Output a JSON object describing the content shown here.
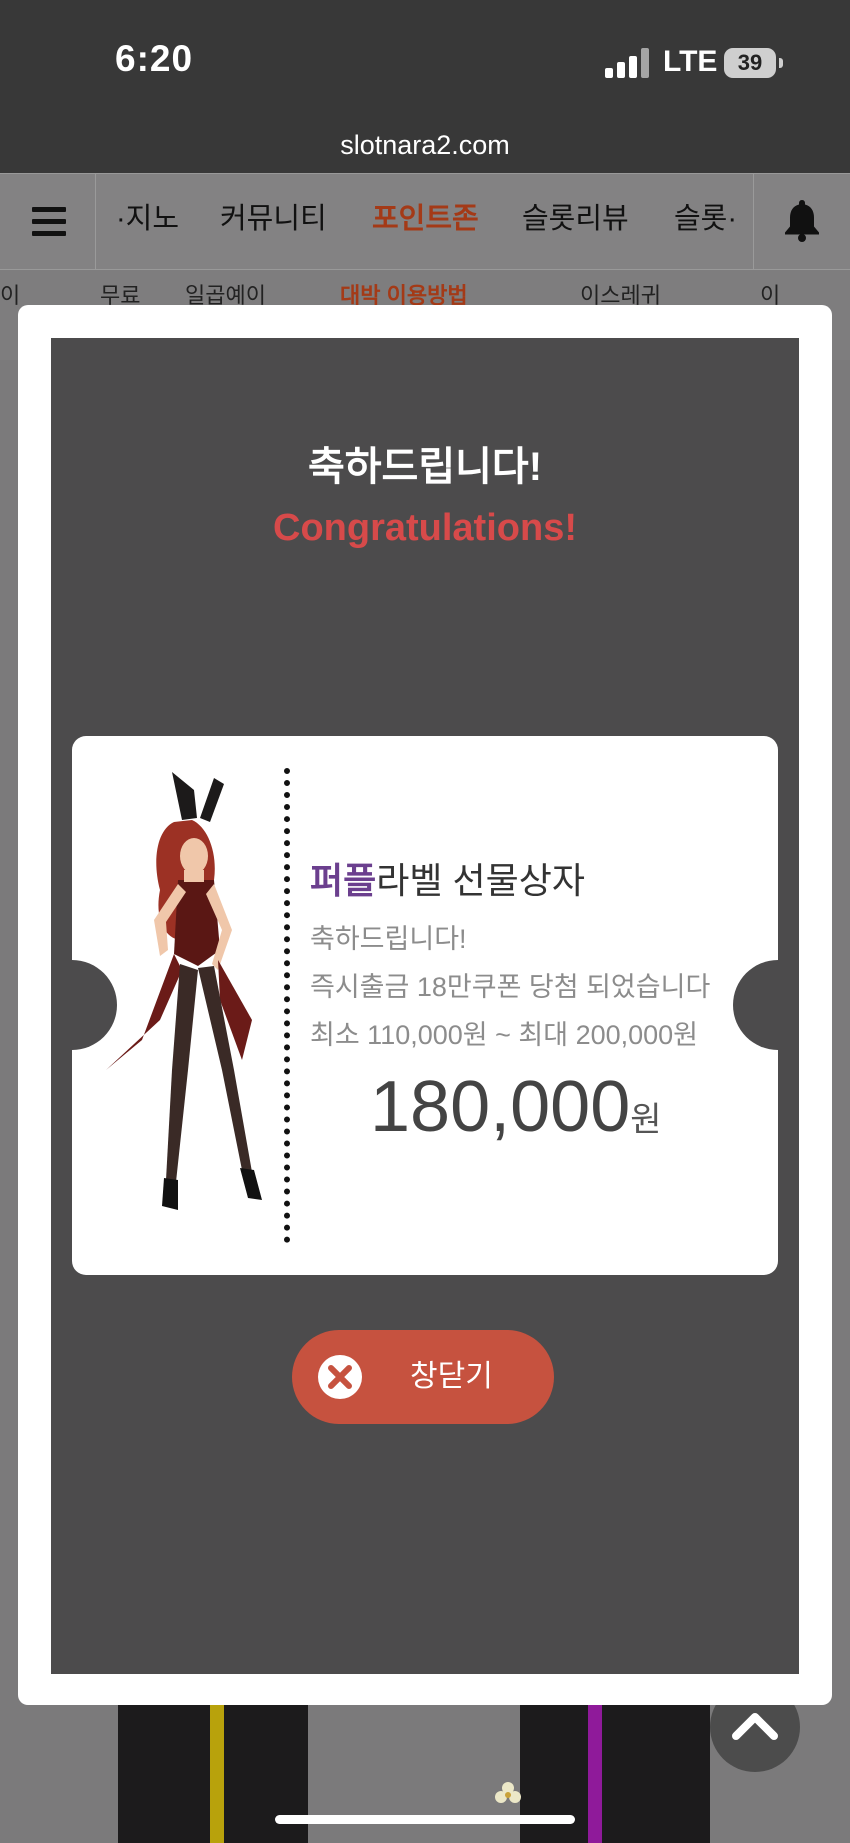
{
  "status_bar": {
    "time": "6:20",
    "network": "LTE",
    "battery": "39"
  },
  "browser": {
    "url": "slotnara2.com"
  },
  "nav": {
    "items": [
      "·지노",
      "커뮤니티",
      "포인트존",
      "슬롯리뷰",
      "슬롯·"
    ],
    "active_index": 2,
    "active_color": "#a43a17"
  },
  "subnav": {
    "items": [
      "이",
      "무료",
      "일곱예이",
      "대박 이용방법",
      "이스레귀",
      "이"
    ]
  },
  "modal": {
    "title_ko": "축하드립니다!",
    "title_en": "Congratulations!",
    "title_en_color": "#d74a4a",
    "ticket": {
      "product_highlight": "퍼플",
      "product_rest": "라벨 선물상자",
      "line1": "축하드립니다!",
      "line2": "즉시출금 18만쿠폰 당첨 되었습니다",
      "line3": "최소 110,000원 ~ 최대 200,000원",
      "amount": "180,000",
      "amount_unit": "원"
    },
    "close_button": {
      "label": "창닫기",
      "icon": "close-x-icon",
      "color": "#c6523f"
    }
  }
}
